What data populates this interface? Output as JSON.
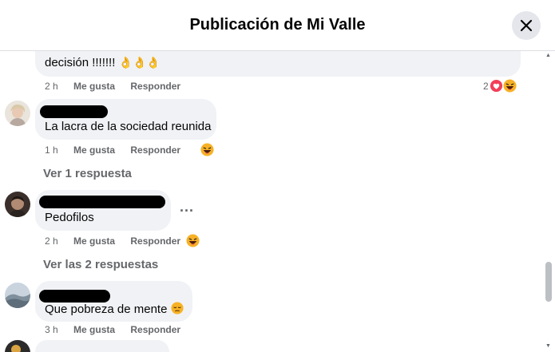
{
  "dialog": {
    "title": "Publicación de Mi Valle",
    "close_icon": "close-icon"
  },
  "comments": [
    {
      "text": "decisión !!!!!!!",
      "time": "2 h",
      "like": "Me gusta",
      "reply": "Responder",
      "reaction_count": "2",
      "reaction_icons": [
        "love-reaction-icon",
        "haha-reaction-icon"
      ]
    },
    {
      "text": "La lacra de la sociedad reunida",
      "time": "1 h",
      "like": "Me gusta",
      "reply": "Responder",
      "reaction_icons": [
        "haha-reaction-icon"
      ],
      "replies_link": "Ver 1 respuesta"
    },
    {
      "text": "Pedofilos",
      "time": "2 h",
      "like": "Me gusta",
      "reply": "Responder",
      "reaction_icons": [
        "haha-reaction-icon"
      ],
      "replies_link": "Ver las 2 respuestas",
      "more_options": "..."
    },
    {
      "text": "Que pobreza de mente",
      "time": "3 h",
      "like": "Me gusta",
      "reply": "Responder"
    }
  ],
  "colors": {
    "bubble": "#f0f2f5",
    "meta_text": "#65676b",
    "love": "#f33e58",
    "haha": "#f7b125"
  }
}
